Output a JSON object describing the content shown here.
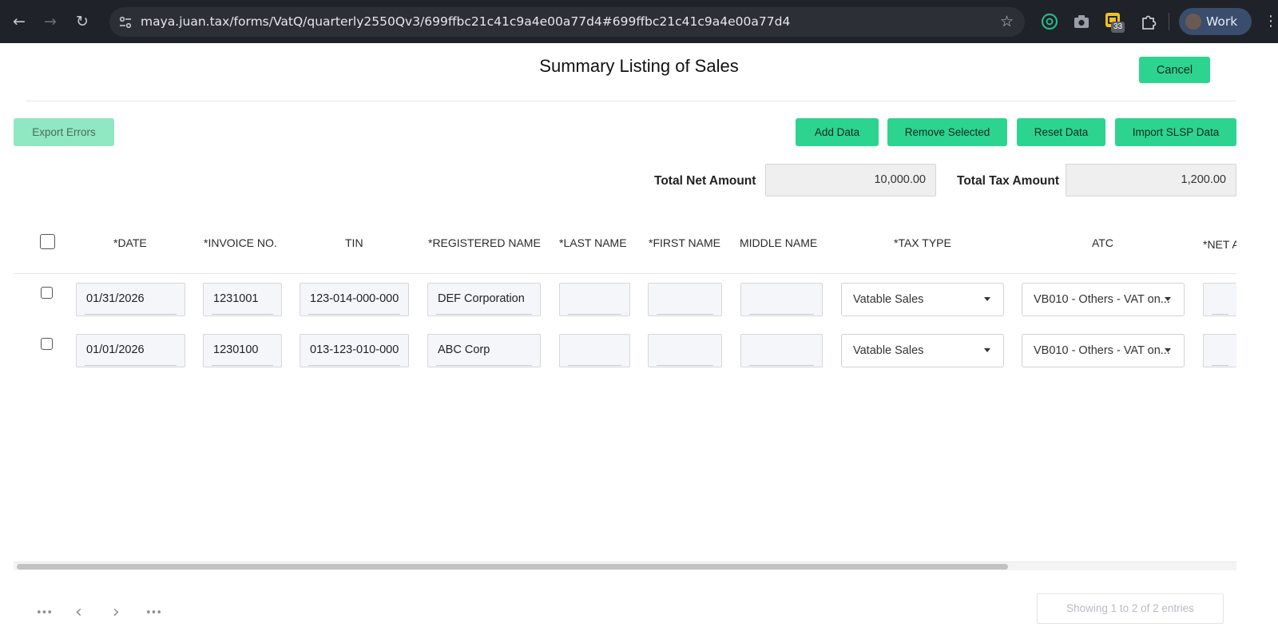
{
  "browser": {
    "url": "maya.juan.tax/forms/VatQ/quarterly2550Qv3/699ffbc21c41c9a4e00a77d4#699ffbc21c41c9a4e00a77d4",
    "extension_badge": "33",
    "profile_name": "Work",
    "icons": {
      "back": "←",
      "forward": "→",
      "reload": "↻",
      "star": "☆",
      "kebab": "⋮"
    }
  },
  "header": {
    "title": "Summary Listing of Sales",
    "cancel_label": "Cancel"
  },
  "toolbar": {
    "export_errors": "Export Errors",
    "add_data": "Add Data",
    "remove_selected": "Remove Selected",
    "reset_data": "Reset Data",
    "import_slsp": "Import SLSP Data"
  },
  "totals": {
    "net_label": "Total Net Amount",
    "net_value": "10,000.00",
    "tax_label": "Total Tax Amount",
    "tax_value": "1,200.00"
  },
  "table": {
    "headers": {
      "date": "*DATE",
      "invoice": "*INVOICE NO.",
      "tin": "TIN",
      "registered_name": "*REGISTERED NAME",
      "last_name": "*LAST NAME",
      "first_name": "*FIRST NAME",
      "middle_name": "MIDDLE NAME",
      "tax_type": "*TAX TYPE",
      "atc": "ATC",
      "net": "*NET A"
    },
    "rows": [
      {
        "date": "01/31/2026",
        "invoice": "1231001",
        "tin": "123-014-000-000",
        "registered_name": "DEF Corporation",
        "last_name": "",
        "first_name": "",
        "middle_name": "",
        "tax_type": "Vatable Sales",
        "atc": "VB010 - Others - VAT on..."
      },
      {
        "date": "01/01/2026",
        "invoice": "1230100",
        "tin": "013-123-010-000",
        "registered_name": "ABC Corp",
        "last_name": "",
        "first_name": "",
        "middle_name": "",
        "tax_type": "Vatable Sales",
        "atc": "VB010 - Others - VAT on..."
      }
    ]
  },
  "pagination": {
    "first": "•••",
    "prev": "‹",
    "next": "›",
    "last": "•••",
    "entries_text": "Showing 1 to 2 of 2 entries"
  },
  "colors": {
    "accent": "#2cd48f",
    "accent_disabled": "#8fe8c1",
    "chrome_bg": "#1f2229"
  }
}
